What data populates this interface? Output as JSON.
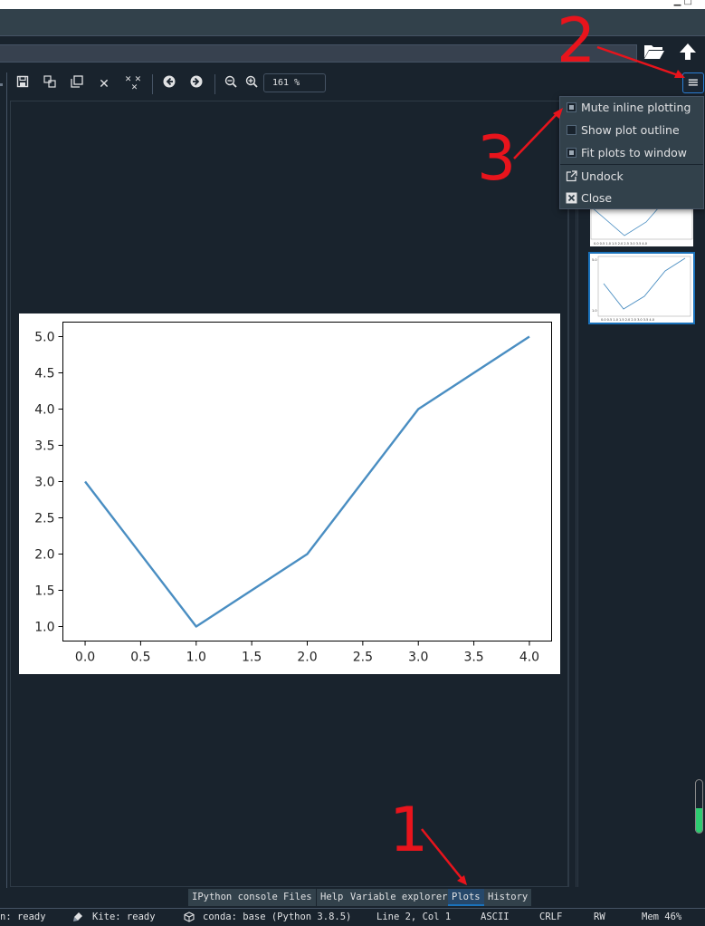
{
  "colors": {
    "background": "#19232d",
    "panel": "#32414b",
    "accent": "#1a72bb",
    "annotation": "#e8141c",
    "line": "#4a8ec2"
  },
  "window": {
    "top_right": "▁ □"
  },
  "path_toolbar": {
    "icons": [
      "open-folder-icon",
      "arrow-up-icon"
    ]
  },
  "plots_toolbar": {
    "icons": [
      "save-icon",
      "save-all-icon",
      "copy-icon",
      "remove-icon",
      "remove-all-icon",
      "previous-icon",
      "next-icon",
      "zoom-out-icon",
      "zoom-in-icon"
    ],
    "zoom_value": "161 %",
    "options_icon": "hamburger-menu-icon"
  },
  "options_menu": {
    "items": [
      {
        "label": "Mute inline plotting",
        "checked": true
      },
      {
        "label": "Show plot outline",
        "checked": false
      },
      {
        "label": "Fit plots to window",
        "checked": true
      },
      {
        "label": "Undock",
        "icon": "undock-icon"
      },
      {
        "label": "Close",
        "icon": "close-icon"
      }
    ]
  },
  "chart_data": {
    "type": "line",
    "x": [
      0,
      1,
      2,
      3,
      4
    ],
    "series": [
      {
        "values": [
          3,
          1,
          2,
          4,
          5
        ]
      }
    ],
    "xlim": [
      -0.2,
      4.2
    ],
    "ylim": [
      0.8,
      5.2
    ],
    "xticks": [
      "0.0",
      "0.5",
      "1.0",
      "1.5",
      "2.0",
      "2.5",
      "3.0",
      "3.5",
      "4.0"
    ],
    "yticks": [
      "1.0",
      "1.5",
      "2.0",
      "2.5",
      "3.0",
      "3.5",
      "4.0",
      "4.5",
      "5.0"
    ],
    "grid": false,
    "color": "#4a8ec2"
  },
  "thumbnails": {
    "count": 2,
    "selected": 1
  },
  "memory_gauge": {
    "fill_fraction": 0.46
  },
  "bottom_tabs": [
    {
      "label": "IPython console",
      "active": false
    },
    {
      "label": "Files",
      "active": false
    },
    {
      "label": "Help",
      "active": false
    },
    {
      "label": "Variable explorer",
      "active": false
    },
    {
      "label": "Plots",
      "active": true
    },
    {
      "label": "History",
      "active": false
    }
  ],
  "statusbar": {
    "lsp": "n: ready",
    "kite": "Kite: ready",
    "conda": "conda: base (Python 3.8.5)",
    "cursor": "Line 2, Col 1",
    "encoding": "ASCII",
    "eol": "CRLF",
    "permissions": "RW",
    "memory": "Mem 46%"
  },
  "annotations": {
    "n1": "1",
    "n2": "2",
    "n3": "3"
  }
}
